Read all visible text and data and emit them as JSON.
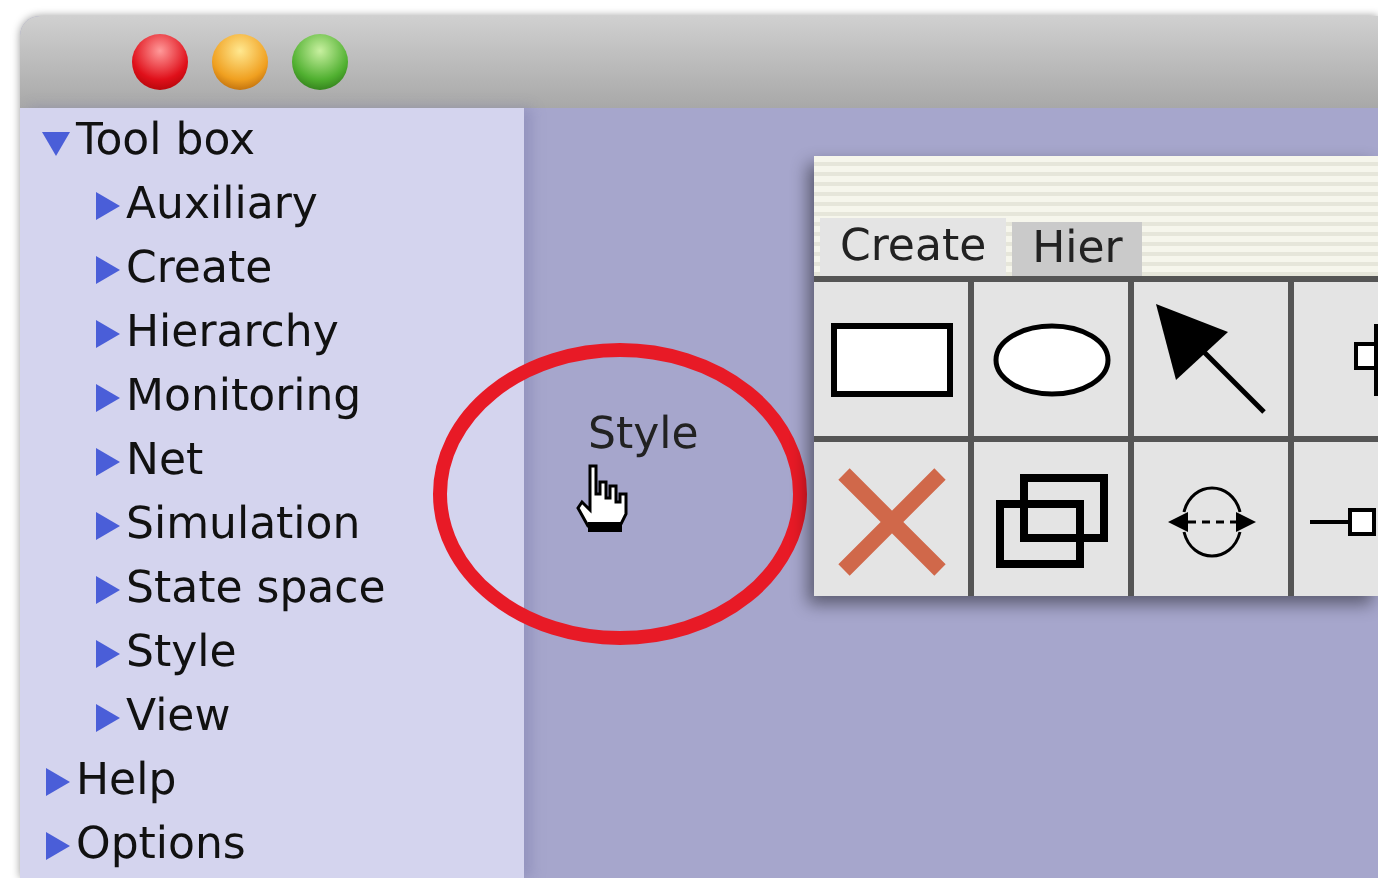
{
  "tree": [
    {
      "label": "Tool box",
      "expanded": true,
      "children": [
        {
          "label": "Auxiliary",
          "expanded": false
        },
        {
          "label": "Create",
          "expanded": false
        },
        {
          "label": "Hierarchy",
          "expanded": false
        },
        {
          "label": "Monitoring",
          "expanded": false
        },
        {
          "label": "Net",
          "expanded": false
        },
        {
          "label": "Simulation",
          "expanded": false
        },
        {
          "label": "State space",
          "expanded": false
        },
        {
          "label": "Style",
          "expanded": false
        },
        {
          "label": "View",
          "expanded": false
        }
      ]
    },
    {
      "label": "Help",
      "expanded": false
    },
    {
      "label": "Options",
      "expanded": false
    }
  ],
  "drag_label": "Style",
  "palette": {
    "tabs": [
      {
        "label": "Create",
        "selected": true
      },
      {
        "label": "Hier",
        "selected": false
      }
    ]
  }
}
